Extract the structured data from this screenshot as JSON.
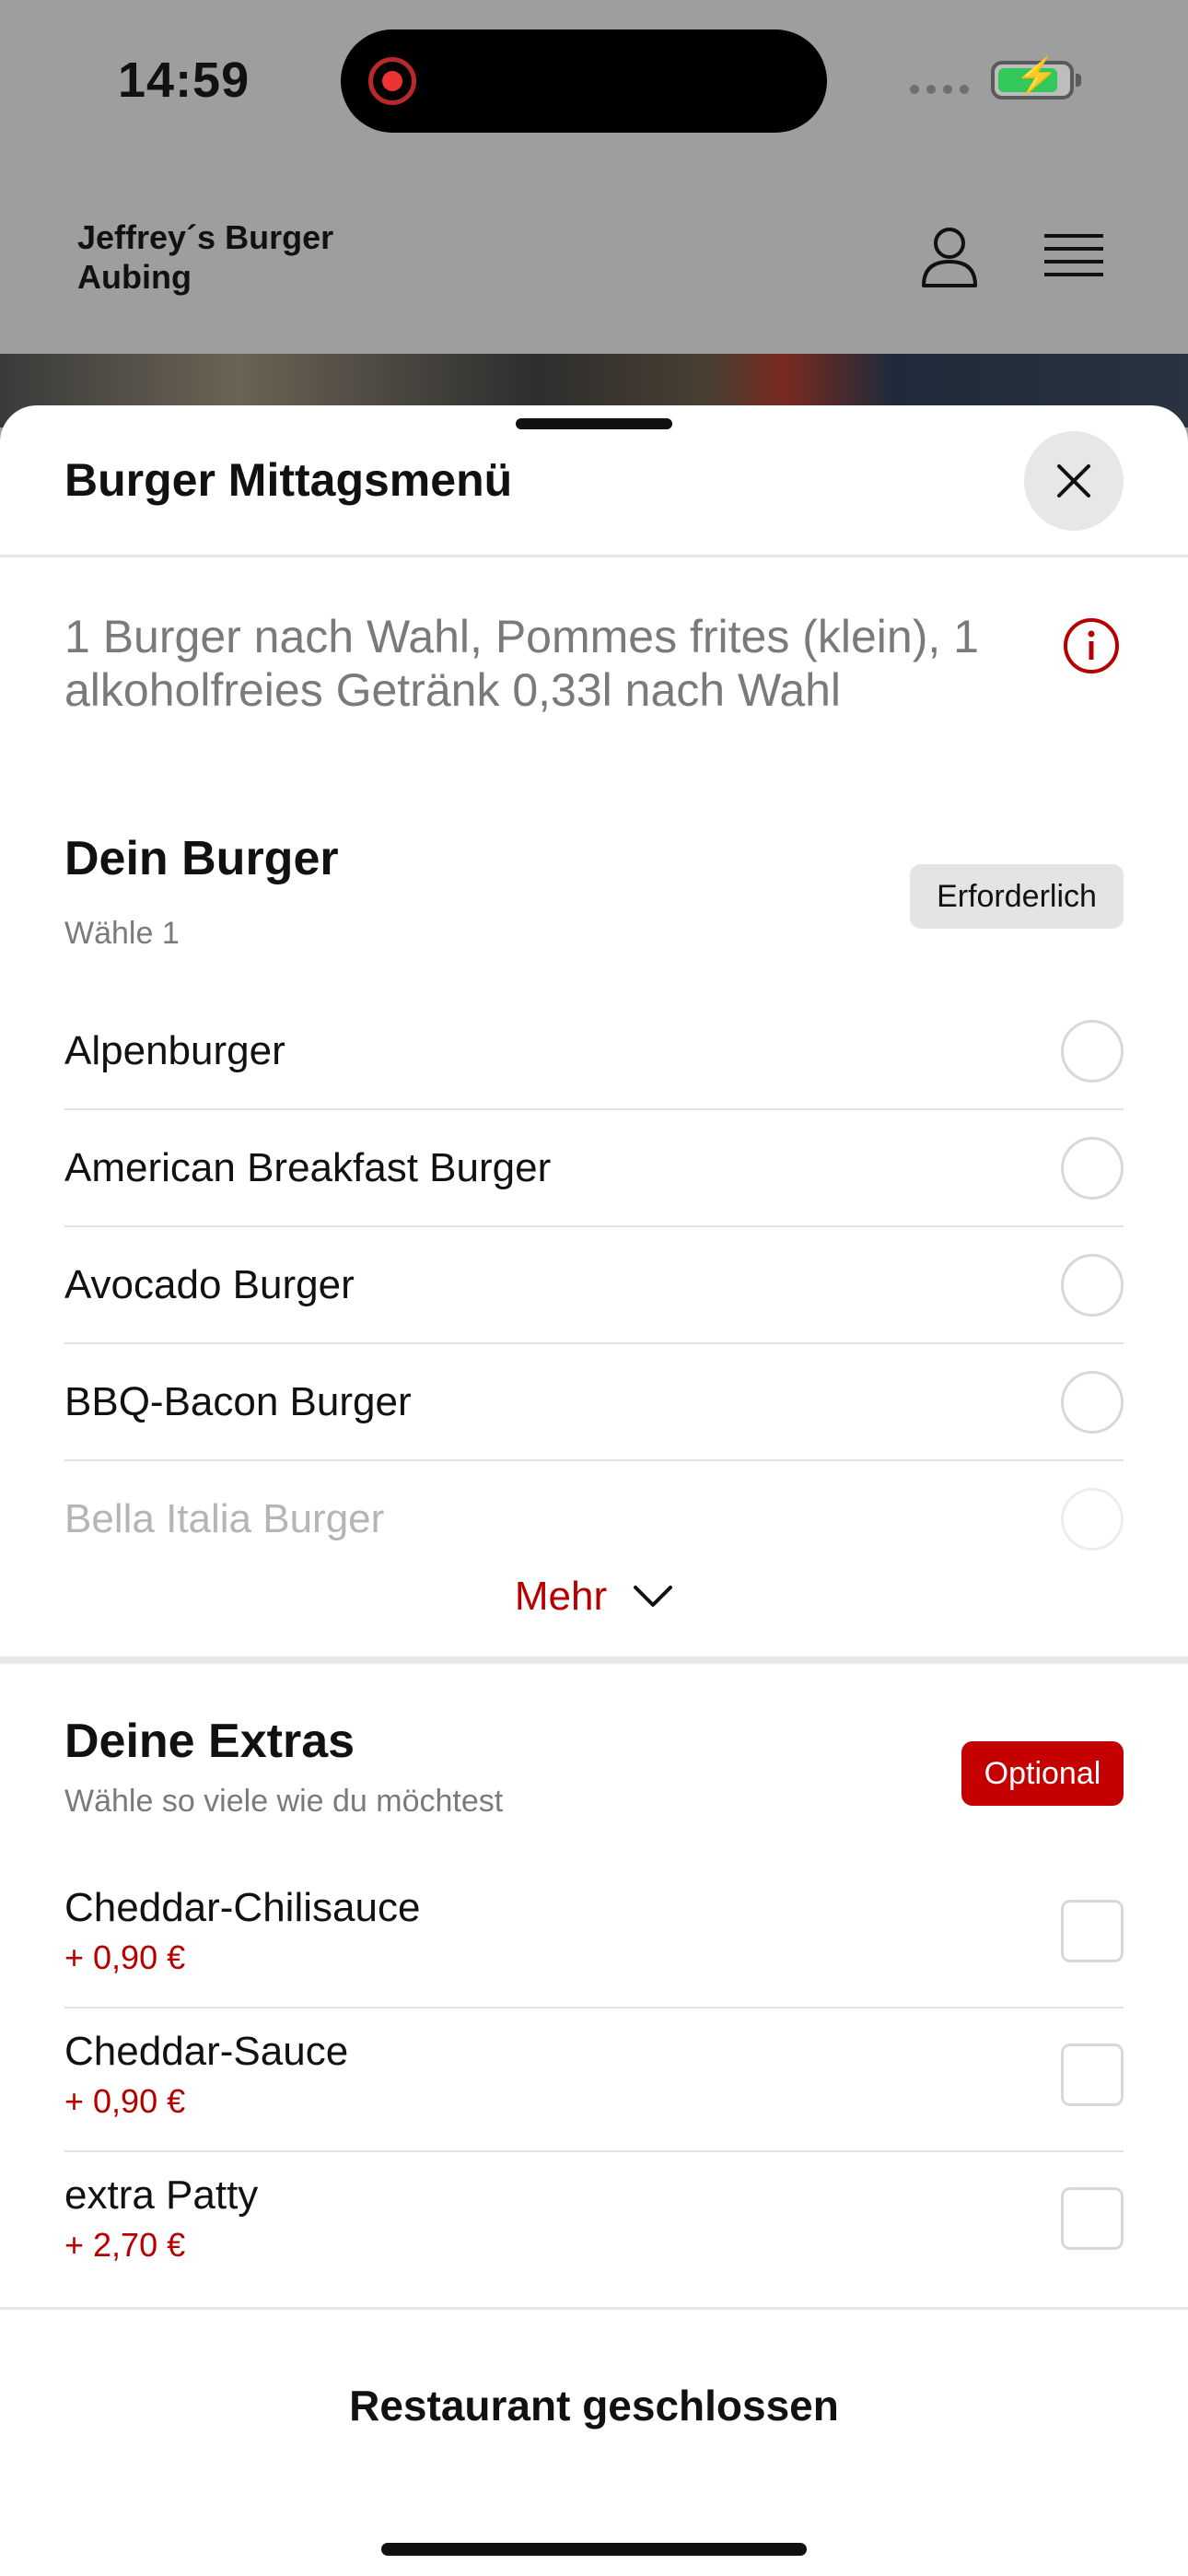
{
  "status": {
    "time": "14:59"
  },
  "header": {
    "brand": "Jeffrey´s Burger Aubing"
  },
  "sheet": {
    "title": "Burger Mittagsmenü",
    "description": "1 Burger nach Wahl, Pommes frites (klein), 1 alkoholfreies Getränk 0,33l nach Wahl"
  },
  "burger_section": {
    "title": "Dein Burger",
    "subtitle": "Wähle 1",
    "badge": "Erforderlich",
    "options": [
      {
        "label": "Alpenburger"
      },
      {
        "label": "American Breakfast Burger"
      },
      {
        "label": "Avocado Burger"
      },
      {
        "label": "BBQ-Bacon Burger"
      },
      {
        "label": "Bella Italia Burger"
      }
    ],
    "more_label": "Mehr"
  },
  "extras_section": {
    "title": "Deine Extras",
    "subtitle": "Wähle so viele wie du möchtest",
    "badge": "Optional",
    "items": [
      {
        "label": "Cheddar-Chilisauce",
        "price": "+ 0,90 €"
      },
      {
        "label": "Cheddar-Sauce",
        "price": "+ 0,90 €"
      },
      {
        "label": "extra Patty",
        "price": "+ 2,70 €"
      }
    ]
  },
  "footer": {
    "status": "Restaurant geschlossen"
  },
  "colors": {
    "accent": "#c40000",
    "scrim": "#9e9e9e"
  }
}
